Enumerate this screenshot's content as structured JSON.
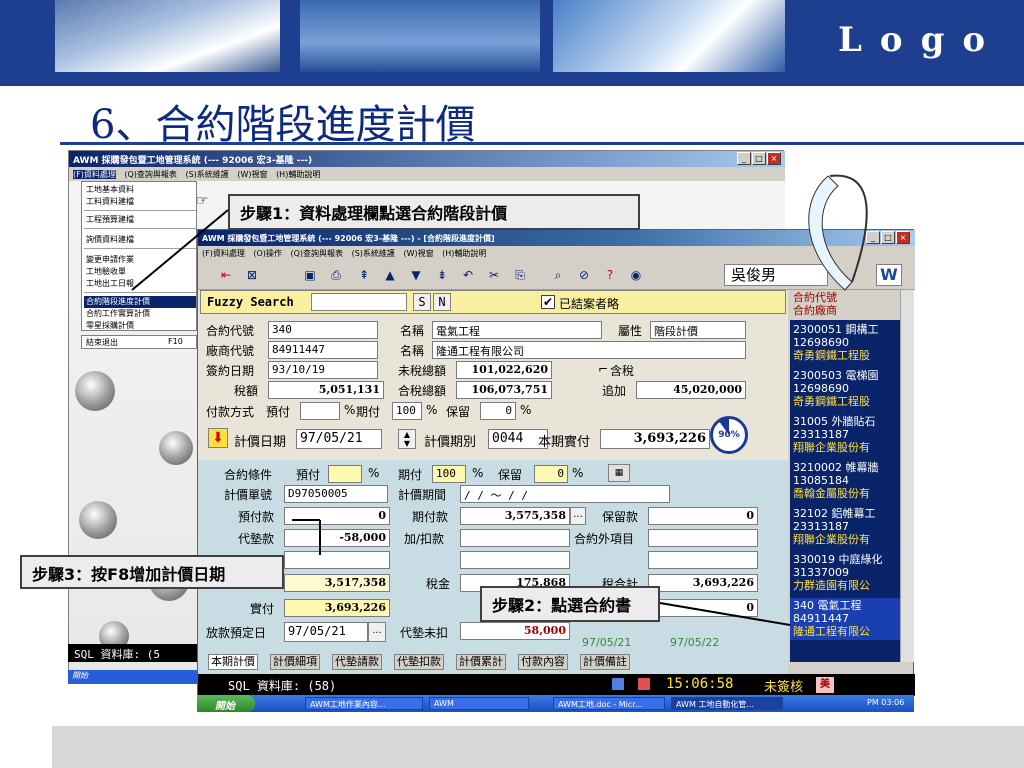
{
  "slide": {
    "logo": "Logo",
    "title": "6、合約階段進度計價"
  },
  "back_window": {
    "title": "AWM 採購發包暨工地管理系統 (--- 92006 宏3-基隆 ---)",
    "menus": [
      "(F)資料處理",
      "(Q)查詢與報表",
      "(S)系統維護",
      "(W)視窗",
      "(H)輔助說明"
    ],
    "menu_items": [
      "工地基本資料",
      "工料資料建檔",
      "工程預算建檔",
      "詢價資料建檔",
      "變更申請作業",
      "工地驗收單",
      "工地出工日報",
      "合約階段進度計價",
      "合約工作實算計價",
      "零星採購計價",
      "結束退出"
    ],
    "exit_shortcut": "F10",
    "sql_label": "SQL 資料庫: (5",
    "start_label": "開始"
  },
  "window": {
    "title": "AWM 採購發包暨工地管理系統 (--- 92006 宏3-基隆 ---) - [合約階段進度計價]",
    "menus": [
      "(F)資料處理",
      "(O)操作",
      "(Q)查詢與報表",
      "(S)系統維護",
      "(W)視窗",
      "(H)輔助說明"
    ],
    "user": "吳俊男",
    "w_icon": "W"
  },
  "fuzzy": {
    "label": "Fuzzy Search",
    "s_label": "S",
    "n_label": "N",
    "check_mark": "✔",
    "closed_label": "已結案者略"
  },
  "contract": {
    "code_label": "合約代號",
    "code": "340",
    "name_label": "名稱",
    "name": "電氣工程",
    "attr_label": "屬性",
    "attr": "階段計價",
    "vendor_label": "廠商代號",
    "vendor_code": "84911447",
    "vendor_name_label": "名稱",
    "vendor_name": "隆通工程有限公司",
    "sign_date_label": "簽約日期",
    "sign_date": "93/10/19",
    "pretax_label": "未稅總額",
    "pretax": "101,022,620",
    "tax_inc_label": "含稅",
    "tax_label": "稅額",
    "tax": "5,051,131",
    "total_label": "合稅總額",
    "total": "106,073,751",
    "add_label": "追加",
    "add": "45,020,000",
    "pay_method_label": "付款方式",
    "prepay_label": "預付",
    "pct_label": "%",
    "period_label": "期付",
    "period_pct": "100",
    "retain_label": "保留",
    "retain_pct": "0",
    "pricing_date_label": "計價日期",
    "pricing_date": "97/05/21",
    "pricing_period_label": "計價期別",
    "pricing_period": "0044",
    "actual_label": "本期實付",
    "actual": "3,693,226",
    "progress": "90%"
  },
  "lower": {
    "terms_label": "合約條件",
    "prepay_label": "預付",
    "pct": "%",
    "period_label": "期付",
    "period_pct": "100",
    "retain_label": "保留",
    "retain_pct": "0",
    "voucher_label": "計價單號",
    "voucher": "D97050005",
    "range_label": "計價期間",
    "range": " /  /   ～   /  /",
    "prepay_amt_label": "預付款",
    "prepay_amt": "0",
    "period_amt_label": "期付款",
    "period_amt": "3,575,358",
    "retain_amt_label": "保留款",
    "retain_amt": "0",
    "advance_label": "代墊款",
    "advance": "-58,000",
    "adjust_label": "加/扣款",
    "extra_label": "合約外項目",
    "subtotal": "3,517,358",
    "tax_label": "稅金",
    "tax": "175,868",
    "tax_total_label": "稅合計",
    "tax_total": "3,693,226",
    "net_label": "實付",
    "net": "3,693,226",
    "zero_right": "0",
    "release_label": "放款預定日",
    "release_date": "97/05/21",
    "unpaid_label": "代墊未扣",
    "unpaid": "58,000",
    "date_a": "97/05/21",
    "date_b": "97/05/22",
    "ellipsis": "..."
  },
  "tabs": [
    "本期計價",
    "計價細項",
    "代墊請款",
    "代墊扣款",
    "計價累計",
    "付款內容",
    "計價備註"
  ],
  "right_list": {
    "header_1": "合約代號",
    "header_2": "合約廠商",
    "items": [
      {
        "l1": "2300051 鋼構工",
        "l2": "12698690",
        "l3": "奇勇鋼鐵工程股"
      },
      {
        "l1": "2300503 電梯園",
        "l2": "12698690",
        "l3": "奇勇鋼鐵工程股"
      },
      {
        "l1": "31005 外牆貼石",
        "l2": "23313187",
        "l3": "翔聯企業股份有"
      },
      {
        "l1": "3210002 帷幕牆",
        "l2": "13085184",
        "l3": "喬翰金屬股份有"
      },
      {
        "l1": "32102 鋁帷幕工",
        "l2": "23313187",
        "l3": "翔聯企業股份有"
      },
      {
        "l1": "330019 中庭綠化",
        "l2": "31337009",
        "l3": "力群造園有限公"
      },
      {
        "l1": "340 電氣工程",
        "l2": "84911447",
        "l3": "隆通工程有限公"
      }
    ]
  },
  "status": {
    "sql": "SQL 資料庫: (58)",
    "clock": "15:06:58",
    "unaudited": "未簽核",
    "lang": "美"
  },
  "taskbar": {
    "start": "開始",
    "items": [
      "AWM工地作業內容...",
      "AWM",
      "AWM工地.doc - Micr...",
      "AWM 工地自動化管..."
    ],
    "time": "PM 03:06"
  },
  "callouts": {
    "step1": "步驟1：資料處理欄點選合約階段計價",
    "step2": "步驟2：點選合約書",
    "step3": "步驟3：按F8增加計價日期"
  }
}
